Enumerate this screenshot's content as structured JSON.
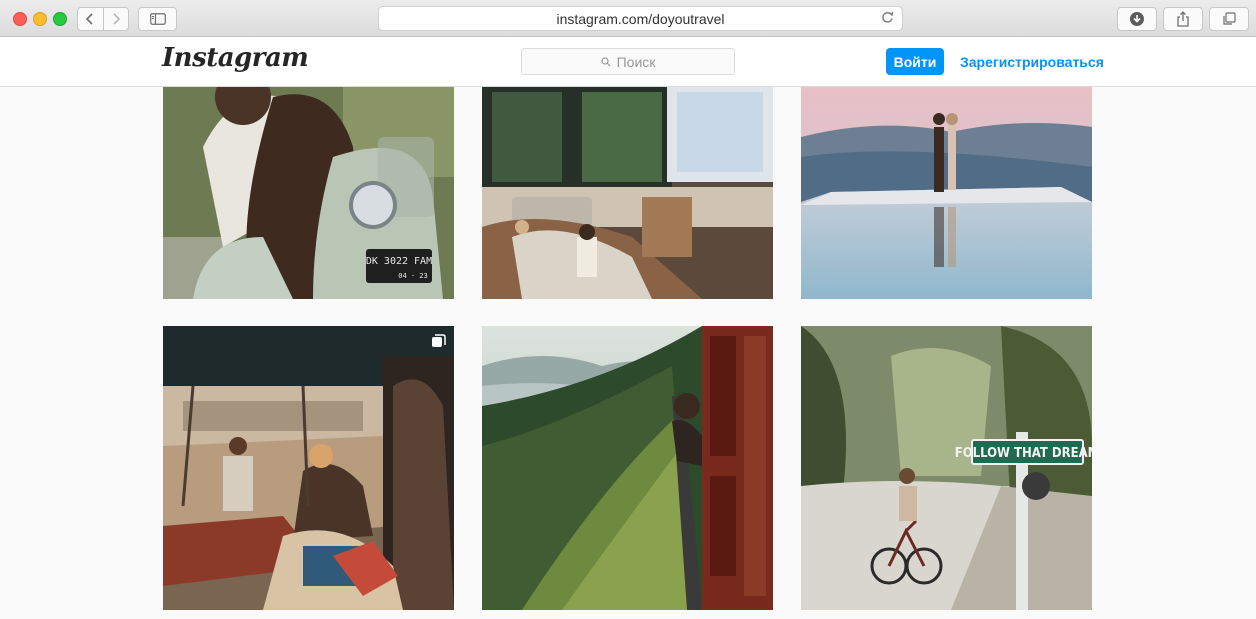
{
  "browser": {
    "url": "instagram.com/doyoutravel"
  },
  "header": {
    "logo": "Instagram",
    "search_placeholder": "Поиск",
    "login_label": "Войти",
    "signup_label": "Зарегистрироваться"
  },
  "posts": [
    {
      "subject": "man-with-dog-on-scooter",
      "plate": "DK 3022 FAM",
      "plate_sub": "04 · 23"
    },
    {
      "subject": "sunken-living-room-projector"
    },
    {
      "subject": "couple-on-infinity-pool"
    },
    {
      "subject": "ghat-market-tent",
      "multi": true
    },
    {
      "subject": "mountain-train-window"
    },
    {
      "subject": "cyclist-follow-that-dream",
      "sign": "FOLLOW THAT DREAM"
    }
  ],
  "colors": {
    "accent": "#0095f6",
    "background": "#fafafa"
  }
}
